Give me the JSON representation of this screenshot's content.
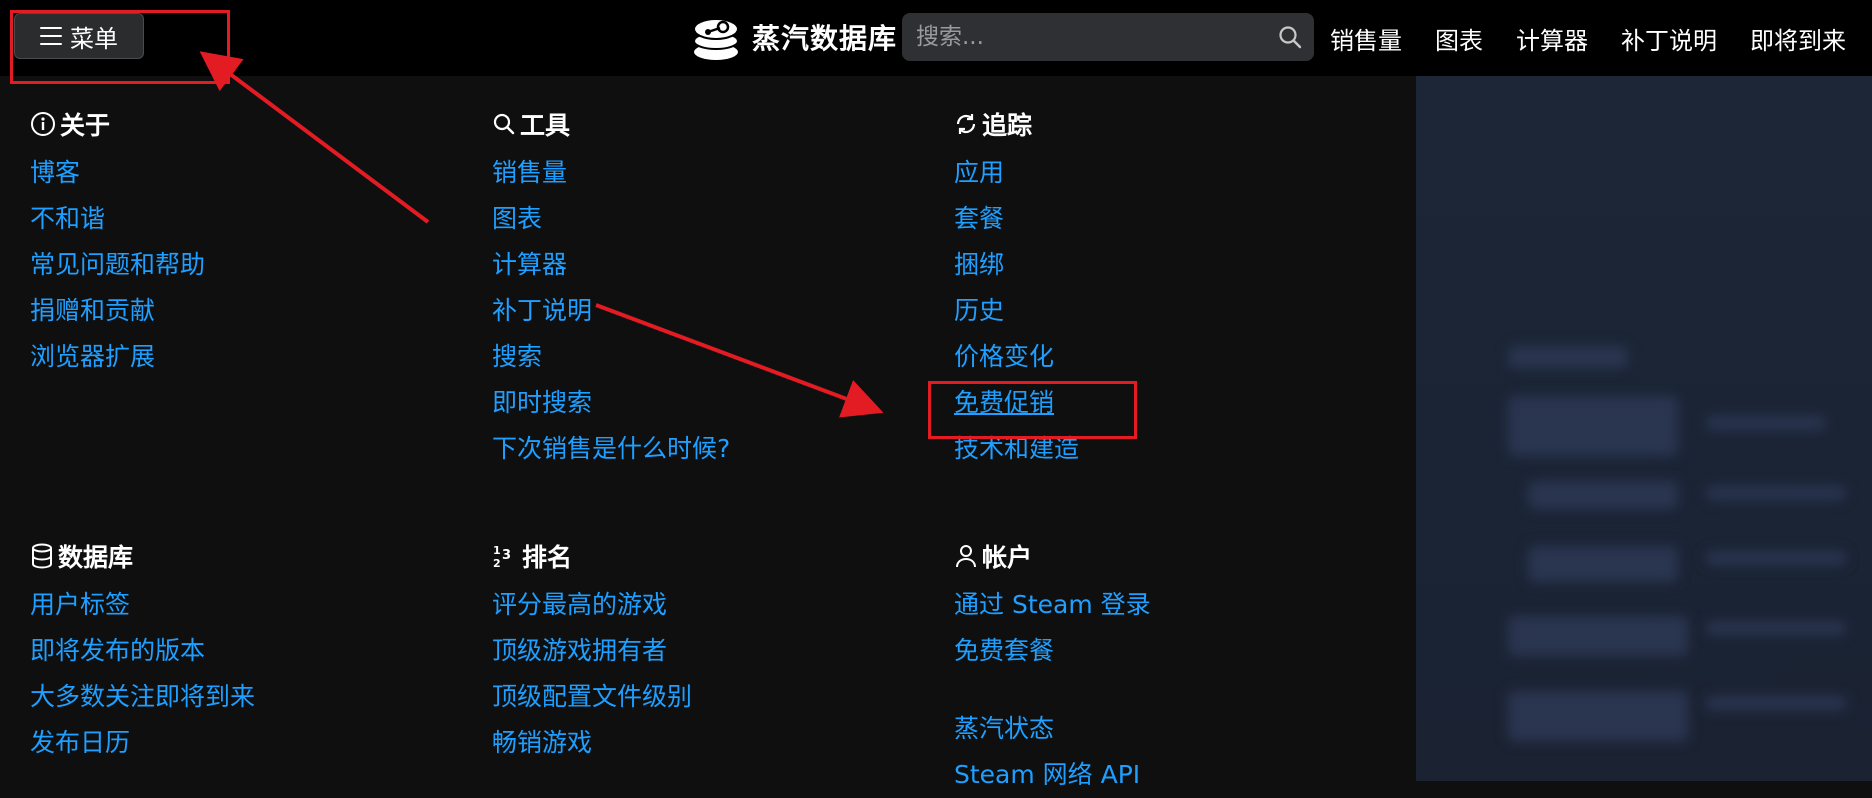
{
  "header": {
    "menu_label": "菜单",
    "brand_name": "蒸汽数据库",
    "search_placeholder": "搜索...",
    "nav": [
      "销售量",
      "图表",
      "计算器",
      "补丁说明",
      "即将到来"
    ]
  },
  "sections": {
    "about": {
      "title": "关于",
      "icon": "info-icon",
      "items": [
        "博客",
        "不和谐",
        "常见问题和帮助",
        "捐赠和贡献",
        "浏览器扩展"
      ]
    },
    "tools": {
      "title": "工具",
      "icon": "search-icon",
      "items": [
        "销售量",
        "图表",
        "计算器",
        "补丁说明",
        "搜索",
        "即时搜索",
        "下次销售是什么时候?"
      ]
    },
    "tracking": {
      "title": "追踪",
      "icon": "refresh-icon",
      "items": [
        "应用",
        "套餐",
        "捆绑",
        "历史",
        "价格变化",
        "免费促销",
        "技术和建造"
      ]
    },
    "database": {
      "title": "数据库",
      "icon": "database-icon",
      "items": [
        "用户标签",
        "即将发布的版本",
        "大多数关注即将到来",
        "发布日历"
      ]
    },
    "rankings": {
      "title": "排名",
      "icon": "ranking-icon",
      "items": [
        "评分最高的游戏",
        "顶级游戏拥有者",
        "顶级配置文件级别",
        "畅销游戏"
      ]
    },
    "account": {
      "title": "帐户",
      "icon": "user-icon",
      "items": [
        "通过 Steam 登录",
        "免费套餐"
      ],
      "items2": [
        "蒸汽状态",
        "Steam 网络 API"
      ]
    }
  },
  "colors": {
    "link": "#1f9fff",
    "header_bg": "#000000",
    "panel_bg": "#0f0f10",
    "annotation": "#e31b23"
  }
}
